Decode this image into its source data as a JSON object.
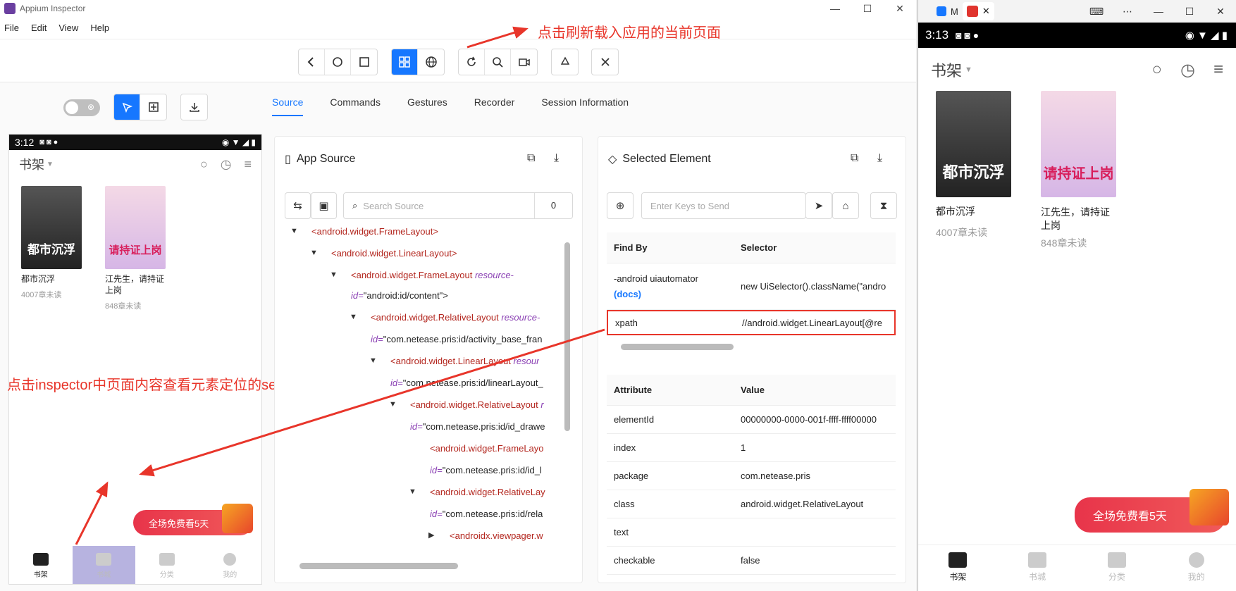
{
  "appium": {
    "title": "Appium Inspector",
    "menu": [
      "File",
      "Edit",
      "View",
      "Help"
    ],
    "annotation_top": "点击刷新载入应用的当前页面",
    "annotation_left": "点击inspector中页面内容查看元素定位的selector",
    "tabs": [
      "Source",
      "Commands",
      "Gestures",
      "Recorder",
      "Session Information"
    ],
    "app_source": {
      "title": "App Source",
      "search_placeholder": "Search Source",
      "match_count": "0",
      "tree": [
        {
          "tag": "<android.widget.FrameLayout>",
          "attr": "",
          "val": ""
        },
        {
          "tag": "<android.widget.LinearLayout>",
          "attr": "",
          "val": ""
        },
        {
          "tag": "<android.widget.FrameLayout",
          "attr": "resource-",
          "val": ""
        },
        {
          "tag": "",
          "attr": "id=",
          "val": "\"android:id/content\">"
        },
        {
          "tag": "<android.widget.RelativeLayout",
          "attr": "resource-",
          "val": ""
        },
        {
          "tag": "",
          "attr": "id=",
          "val": "\"com.netease.pris:id/activity_base_fran"
        },
        {
          "tag": "<android.widget.LinearLayout",
          "attr": "resour",
          "val": ""
        },
        {
          "tag": "",
          "attr": "id=",
          "val": "\"com.netease.pris:id/linearLayout_"
        },
        {
          "tag": "<android.widget.RelativeLayout",
          "attr": "r",
          "val": ""
        },
        {
          "tag": "",
          "attr": "id=",
          "val": "\"com.netease.pris:id/id_drawe"
        },
        {
          "tag": "<android.widget.FrameLayo",
          "attr": "",
          "val": ""
        },
        {
          "tag": "",
          "attr": "id=",
          "val": "\"com.netease.pris:id/id_l"
        },
        {
          "tag": "<android.widget.RelativeLay",
          "attr": "",
          "val": ""
        },
        {
          "tag": "",
          "attr": "id=",
          "val": "\"com.netease.pris:id/rela"
        },
        {
          "tag": "<androidx.viewpager.w",
          "attr": "",
          "val": ""
        }
      ]
    },
    "selected": {
      "title": "Selected Element",
      "keys_placeholder": "Enter Keys to Send",
      "findby_header": [
        "Find By",
        "Selector"
      ],
      "findby": [
        {
          "by": "-android uiautomator",
          "docs": "(docs)",
          "sel": "new UiSelector().className(\"andro"
        },
        {
          "by": "xpath",
          "docs": "",
          "sel": "//android.widget.LinearLayout[@re"
        }
      ],
      "attr_header": [
        "Attribute",
        "Value"
      ],
      "attrs": [
        {
          "k": "elementId",
          "v": "00000000-0000-001f-ffff-ffff00000"
        },
        {
          "k": "index",
          "v": "1"
        },
        {
          "k": "package",
          "v": "com.netease.pris"
        },
        {
          "k": "class",
          "v": "android.widget.RelativeLayout"
        },
        {
          "k": "text",
          "v": ""
        },
        {
          "k": "checkable",
          "v": "false"
        }
      ]
    }
  },
  "mini_phone": {
    "time": "3:12",
    "shelf": "书架",
    "books": [
      {
        "cover_text": "都市沉浮",
        "title": "都市沉浮",
        "sub": "4007章未读"
      },
      {
        "cover_text": "请持证上岗",
        "title": "江先生，请持证上岗",
        "sub": "848章未读"
      }
    ],
    "promo": "全场免费看5天",
    "nav": [
      "书架",
      "书城",
      "分类",
      "我的"
    ]
  },
  "phone": {
    "tab1": "M",
    "time": "3:13",
    "shelf": "书架",
    "books": [
      {
        "cover_text": "都市沉浮",
        "title": "都市沉浮",
        "sub": "4007章未读"
      },
      {
        "cover_text": "请持证上岗",
        "title1": "江先生，请持证",
        "title2": "上岗",
        "sub": "848章未读"
      }
    ],
    "promo": "全场免费看5天",
    "nav": [
      "书架",
      "书城",
      "分类",
      "我的"
    ]
  },
  "colors": {
    "accent": "#1677ff",
    "annotation": "#e8352a",
    "tag": "#b3261e",
    "attr": "#8b41b4"
  }
}
